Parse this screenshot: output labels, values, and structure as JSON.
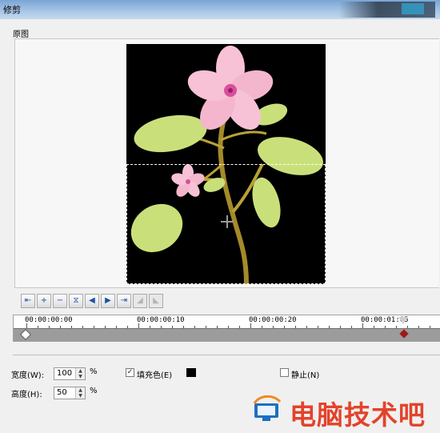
{
  "window": {
    "title": "修剪"
  },
  "original": {
    "label": "原图"
  },
  "toolbar": {
    "buttons": [
      {
        "name": "go-start-icon",
        "glyph": "⇤"
      },
      {
        "name": "zoom-in-icon",
        "glyph": "+"
      },
      {
        "name": "zoom-out-icon",
        "glyph": "−"
      },
      {
        "name": "fit-icon",
        "glyph": "⧖"
      },
      {
        "name": "prev-frame-icon",
        "glyph": "◀"
      },
      {
        "name": "next-frame-icon",
        "glyph": "▶"
      },
      {
        "name": "go-end-icon",
        "glyph": "⇥"
      },
      {
        "name": "mark-in-icon",
        "glyph": "◢"
      },
      {
        "name": "mark-out-icon",
        "glyph": "◣"
      }
    ]
  },
  "timeline": {
    "labels": [
      "00:00:00:00",
      "00:00:00:10",
      "00:00:00:20",
      "00:00:01:05"
    ]
  },
  "form": {
    "width_label": "宽度(W):",
    "width_value": "100",
    "height_label": "高度(H):",
    "height_value": "50",
    "percent": "%",
    "fill_label": "填充色(E)",
    "fill_checked": true,
    "fill_color": "#000000",
    "still_label": "静止(N)",
    "still_checked": false
  },
  "watermark": {
    "text": "电脑技术吧"
  }
}
